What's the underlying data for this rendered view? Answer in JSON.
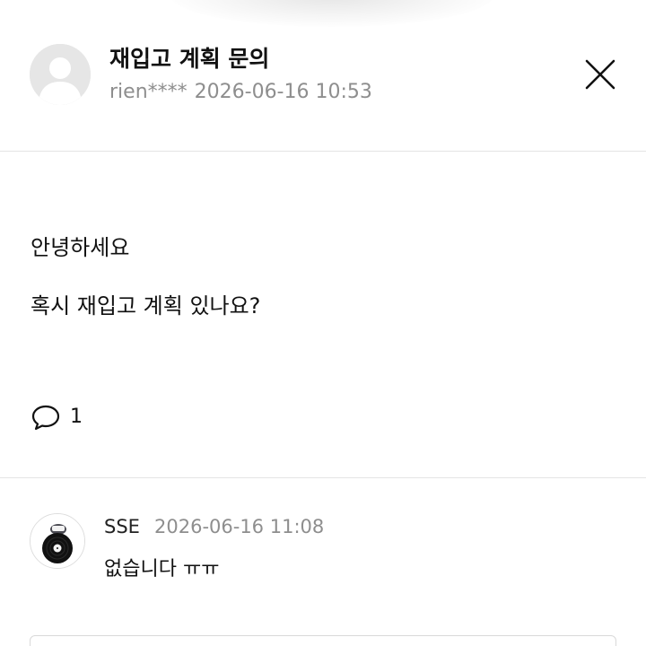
{
  "post": {
    "title": "재입고 계획 문의",
    "author": "rien****",
    "date": "2026-06-16 10:53",
    "lines": [
      "안녕하세요",
      "혹시 재입고 계획 있나요?"
    ],
    "comment_count": "1"
  },
  "icons": {
    "avatar": "default-user-avatar-icon",
    "close": "close-icon",
    "comment": "speech-bubble-icon"
  },
  "comments": [
    {
      "author": "SSE",
      "date": "2026-06-16 11:08",
      "text": "없습니다 ㅠㅠ",
      "avatar": "vinyl-record-avatar"
    }
  ],
  "colors": {
    "text": "#111111",
    "meta": "#8e8e8e",
    "divider": "#e4e4e4",
    "avatar_bg": "#e6e6e6"
  }
}
